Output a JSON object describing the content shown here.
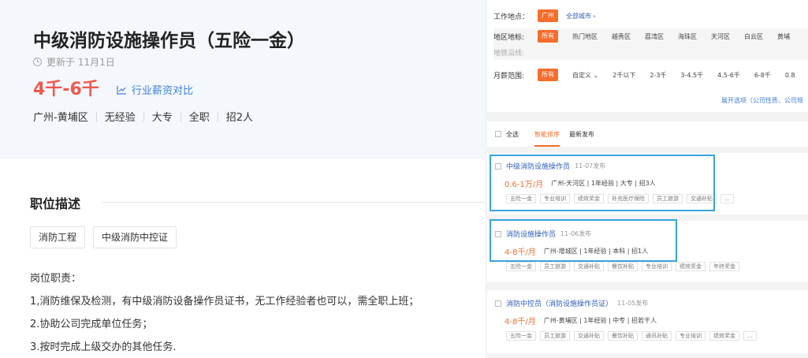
{
  "job": {
    "title": "中级消防设施操作员（五险一金）",
    "updated": "更新于 11月1日",
    "salary": "4千-6千",
    "compare_link": "行业薪资对比",
    "meta": [
      "广州-黄埔区",
      "无经验",
      "大专",
      "全职",
      "招2人"
    ]
  },
  "description": {
    "heading": "职位描述",
    "tags": [
      "消防工程",
      "中级消防中控证"
    ],
    "lines": [
      "岗位职责：",
      "1,消防维保及检测，有中级消防设备操作员证书，无工作经验者也可以，需全职上班；",
      "2.协助公司完成单位任务；",
      "3.按时完成上级交办的其他任务."
    ]
  },
  "filters": {
    "location_label": "工作地点：",
    "location_selected": "广州",
    "all_cities": "全部城市",
    "district_label": "地区地标:",
    "district_all": "所有",
    "districts": [
      "热门地区",
      "越秀区",
      "荔湾区",
      "海珠区",
      "天河区",
      "白云区",
      "黄埔"
    ],
    "metro_label": "地铁沿线:",
    "salary_label": "月薪范围:",
    "salary_all": "所有",
    "salary_custom": "自定义",
    "salary_ranges": [
      "2千以下",
      "2-3千",
      "3-4.5千",
      "4.5-6千",
      "6-8千",
      "0.8"
    ],
    "more_options": "展开选项（公司性质、公司规"
  },
  "sort": {
    "select_all": "全选",
    "smart": "智能排序",
    "latest": "最新发布"
  },
  "listings": [
    {
      "title": "中级消防设施操作员",
      "published": "11-07发布",
      "salary": "0.6-1万/月",
      "info": "广州-天河区 | 1年经验 | 大专 | 招3人",
      "benefits": [
        "五险一金",
        "专业培训",
        "绩效奖金",
        "补充医疗保险",
        "员工旅游",
        "交通补贴",
        "..."
      ]
    },
    {
      "title": "消防设施操作员",
      "published": "11-06发布",
      "salary": "4-8千/月",
      "info": "广州-增城区 | 1年经验 | 本科 | 招1人",
      "benefits": [
        "五险一金",
        "员工旅游",
        "交通补贴",
        "餐饮补贴",
        "专业培训",
        "绩效奖金",
        "年终奖金"
      ]
    },
    {
      "title": "消防中控员（消防设施操作员证）",
      "published": "11-05发布",
      "salary": "4-8千/月",
      "info": "广州-黄埔区 | 1年经验 | 中专 | 招若干人",
      "benefits": [
        "五险一金",
        "员工旅游",
        "交通补贴",
        "餐饮补贴",
        "通讯补贴",
        "专业培训",
        "绩效奖金",
        "..."
      ]
    }
  ],
  "colors": {
    "accent_orange": "#f66d2c",
    "salary_red": "#f2584d",
    "link_blue": "#3f7ed8",
    "highlight_blue": "#39a3dd"
  }
}
